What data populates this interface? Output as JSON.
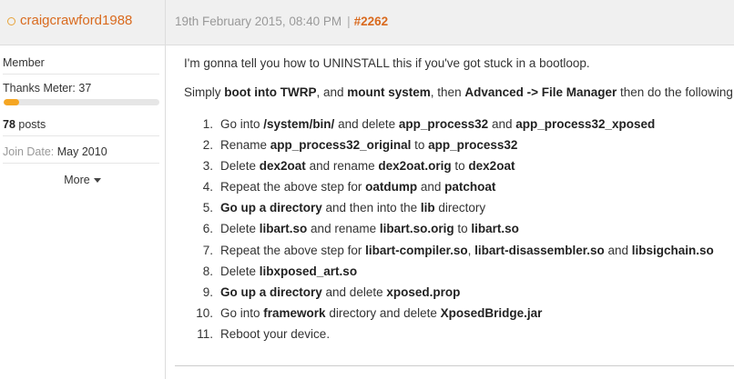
{
  "user": {
    "username": "craigcrawford1988",
    "title": "Member",
    "thanks_meter_label": "Thanks Meter: 37",
    "thanks_meter_fill": 0.1,
    "posts_count": "78",
    "posts_label": " posts",
    "join_date_label": "Join Date: ",
    "join_date_value": "May 2010",
    "more_label": "More"
  },
  "post": {
    "date": "19th February 2015, 08:40 PM",
    "separator": "|",
    "number": "#2262",
    "intro": "I'm gonna tell you how to UNINSTALL this if you've got stuck in a bootloop.",
    "instructions": [
      {
        "t": "Simply ",
        "b": false
      },
      {
        "t": "boot into TWRP",
        "b": true
      },
      {
        "t": ", and ",
        "b": false
      },
      {
        "t": "mount system",
        "b": true
      },
      {
        "t": ", then ",
        "b": false
      },
      {
        "t": "Advanced -> File Manager",
        "b": true
      },
      {
        "t": " then do the following:",
        "b": false
      }
    ],
    "steps": [
      {
        "num": "1.",
        "parts": [
          {
            "t": "Go into ",
            "b": false
          },
          {
            "t": "/system/bin/",
            "b": true
          },
          {
            "t": " and delete ",
            "b": false
          },
          {
            "t": "app_process32",
            "b": true
          },
          {
            "t": " and ",
            "b": false
          },
          {
            "t": "app_process32_xposed",
            "b": true
          }
        ]
      },
      {
        "num": "2.",
        "parts": [
          {
            "t": "Rename ",
            "b": false
          },
          {
            "t": "app_process32_original",
            "b": true
          },
          {
            "t": " to ",
            "b": false
          },
          {
            "t": "app_process32",
            "b": true
          }
        ]
      },
      {
        "num": "3.",
        "parts": [
          {
            "t": "Delete ",
            "b": false
          },
          {
            "t": "dex2oat",
            "b": true
          },
          {
            "t": " and rename ",
            "b": false
          },
          {
            "t": "dex2oat.orig",
            "b": true
          },
          {
            "t": " to ",
            "b": false
          },
          {
            "t": "dex2oat",
            "b": true
          }
        ]
      },
      {
        "num": "4.",
        "parts": [
          {
            "t": "Repeat the above step for ",
            "b": false
          },
          {
            "t": "oatdump",
            "b": true
          },
          {
            "t": " and ",
            "b": false
          },
          {
            "t": "patchoat",
            "b": true
          }
        ]
      },
      {
        "num": "5.",
        "parts": [
          {
            "t": "Go up a directory",
            "b": true
          },
          {
            "t": " and then into the ",
            "b": false
          },
          {
            "t": "lib",
            "b": true
          },
          {
            "t": " directory",
            "b": false
          }
        ]
      },
      {
        "num": "6.",
        "parts": [
          {
            "t": "Delete ",
            "b": false
          },
          {
            "t": "libart.so",
            "b": true
          },
          {
            "t": " and rename ",
            "b": false
          },
          {
            "t": "libart.so.orig",
            "b": true
          },
          {
            "t": " to ",
            "b": false
          },
          {
            "t": "libart.so",
            "b": true
          }
        ]
      },
      {
        "num": "7.",
        "parts": [
          {
            "t": "Repeat the above step for ",
            "b": false
          },
          {
            "t": "libart-compiler.so",
            "b": true
          },
          {
            "t": ", ",
            "b": false
          },
          {
            "t": "libart-disassembler.so",
            "b": true
          },
          {
            "t": " and ",
            "b": false
          },
          {
            "t": "libsigchain.so",
            "b": true
          }
        ]
      },
      {
        "num": "8.",
        "parts": [
          {
            "t": "Delete ",
            "b": false
          },
          {
            "t": "libxposed_art.so",
            "b": true
          }
        ]
      },
      {
        "num": "9.",
        "parts": [
          {
            "t": "Go up a directory",
            "b": true
          },
          {
            "t": " and delete ",
            "b": false
          },
          {
            "t": "xposed.prop",
            "b": true
          }
        ]
      },
      {
        "num": "10.",
        "parts": [
          {
            "t": "Go into ",
            "b": false
          },
          {
            "t": "framework",
            "b": true
          },
          {
            "t": " directory and delete ",
            "b": false
          },
          {
            "t": "XposedBridge.jar",
            "b": true
          }
        ]
      },
      {
        "num": "11.",
        "parts": [
          {
            "t": "Reboot your device.",
            "b": false
          }
        ]
      }
    ]
  },
  "colors": {
    "accent": "#d96a1e",
    "meter": "#f5a623",
    "header_bg": "#f0f0f0"
  },
  "icons": {
    "online_status": "online-status-icon",
    "more_caret": "caret-down-icon"
  }
}
